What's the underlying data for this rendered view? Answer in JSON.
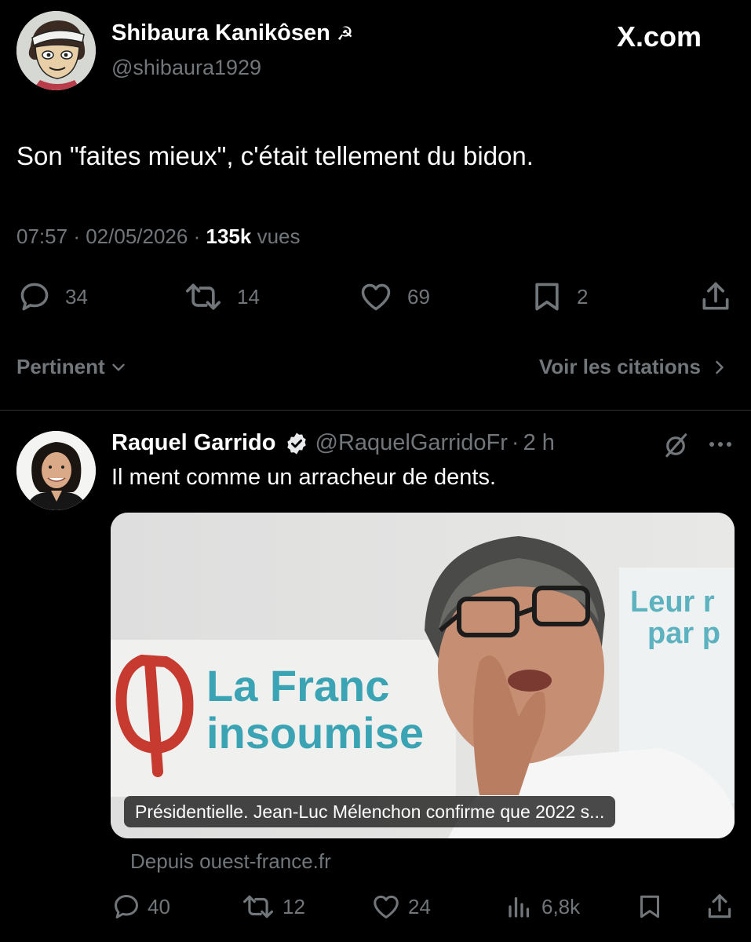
{
  "tweet": {
    "author_name": "Shibaura Kanikôsen",
    "author_emoji": "☭",
    "author_handle": "@shibaura1929",
    "site": "X.com",
    "text": "Son \"faites mieux\", c'était tellement du bidon.",
    "time": "07:57",
    "date": "02/05/2026",
    "views_count": "135k",
    "views_label": "vues",
    "sep": "·",
    "actions": {
      "replies": "34",
      "retweets": "14",
      "likes": "69",
      "bookmarks": "2"
    }
  },
  "sort": {
    "label": "Pertinent"
  },
  "quotes_link": {
    "label": "Voir les citations"
  },
  "reply": {
    "author_name": "Raquel Garrido",
    "author_handle": "@RaquelGarridoFr",
    "sep": "·",
    "time": "2 h",
    "text": "Il ment comme un arracheur de dents.",
    "card": {
      "caption": "Présidentielle. Jean-Luc Mélenchon confirme que 2022 s...",
      "source": "Depuis ouest-france.fr",
      "banner_line1": "La Franc",
      "banner_line2": "insoumise",
      "poster_line1": "Leur r",
      "poster_line2": "par p"
    },
    "actions": {
      "replies": "40",
      "retweets": "12",
      "likes": "24",
      "views": "6,8k"
    }
  },
  "colors": {
    "background": "#000000",
    "text": "#e7e9ea",
    "muted": "#71767b",
    "verified": "#e7e9ea",
    "accent_red": "#c73a2f",
    "accent_teal": "#3aa3b4"
  }
}
